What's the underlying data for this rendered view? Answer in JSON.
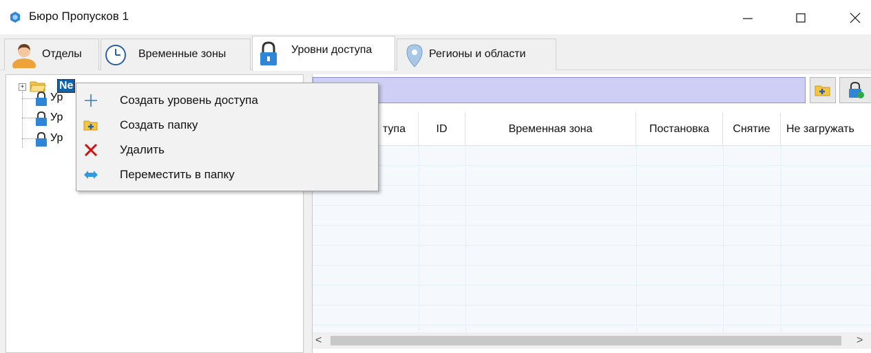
{
  "window": {
    "title": "Бюро Пропусков 1",
    "minimize_glyph": "—",
    "maximize_glyph": "☐",
    "close_glyph": "✕"
  },
  "tabs": [
    {
      "label": "Отделы",
      "icon": "person-icon",
      "active": false
    },
    {
      "label": "Временные зоны",
      "icon": "clock-icon",
      "active": false
    },
    {
      "label": "Уровни доступа",
      "icon": "padlock-icon",
      "active": true
    },
    {
      "label": "Регионы и области",
      "icon": "map-pin-icon",
      "active": false
    }
  ],
  "tree": {
    "root_label": "Ne",
    "children": [
      {
        "label": "Ур"
      },
      {
        "label": "Ур"
      },
      {
        "label": "Ур"
      }
    ]
  },
  "context_menu": {
    "items": [
      {
        "label": "Создать уровень доступа",
        "icon": "plus-icon"
      },
      {
        "label": "Создать папку",
        "icon": "new-folder-icon"
      },
      {
        "label": "Удалить",
        "icon": "delete-x-icon"
      },
      {
        "label": "Переместить в папку",
        "icon": "move-arrows-icon"
      }
    ]
  },
  "grid": {
    "columns": [
      "тупа",
      "ID",
      "Временная зона",
      "Постановка",
      "Снятие",
      "Не загружать"
    ]
  },
  "scroll": {
    "left": "<",
    "right": ">"
  },
  "colors": {
    "toolbar_bg": "#cfcff5",
    "selection": "#0a64ad",
    "delete_red": "#d01010",
    "plus_blue": "#3a78c8"
  }
}
